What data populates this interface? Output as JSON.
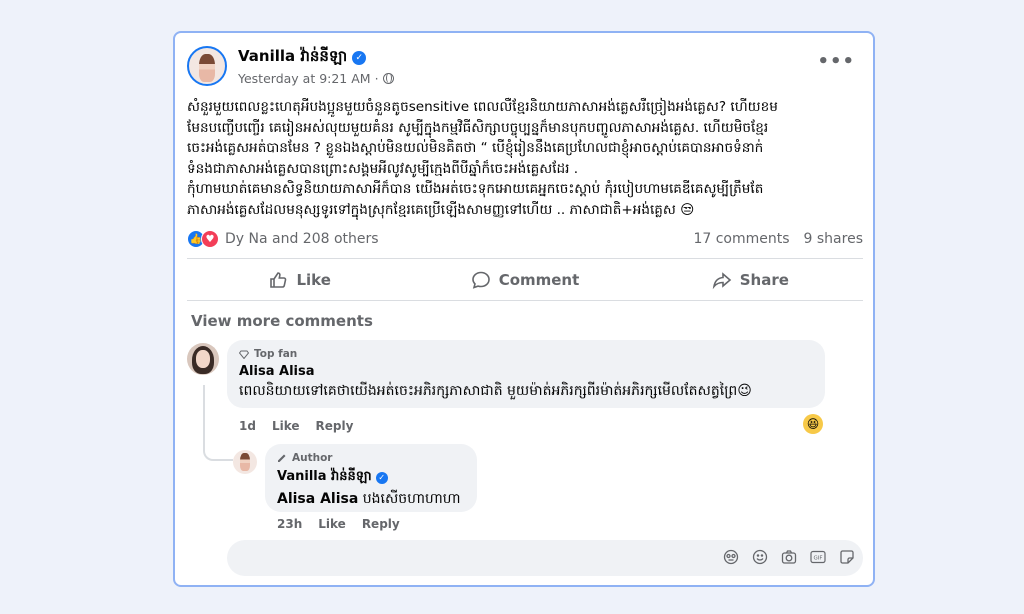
{
  "post": {
    "page_name": "Vanilla វ៉ាន់នីឡា",
    "timestamp": "Yesterday at 9:21 AM",
    "body_lines": [
      "សំនួរមួយពេលខ្លះហេតុអីបងប្អូនមួយចំនួនតូចsensitive ពេលលឺខ្មែរនិយាយភាសាអង់គ្លេសរឺច្រៀងអង់គ្លេស? ហើយខម",
      "មែនបញ្ចើបញ្ចើរ គេរៀនអស់លុយមួយគំនរ សូម្បីក្នុងកម្មវិធីសិក្សាបច្ចុប្បន្នក៏មានបុកបញ្ចូលភាសាអង់គ្លេស. ហើយមិចខ្មែរ",
      "ចេះអង់គ្លេសអត់បានមែន ? ខ្លួនឯងស្ដាប់មិនយល់មិនគិតថា  “ បើខ្ញុំរៀននឹងគេប្រហែលជាខ្ញុំអាចស្តាប់គេបានអាចទំនាក់",
      "ទំនងជាភាសាអង់គ្លេសបានព្រោះសង្គមអីលូវសូម្បីក្មេងពីបីឆ្នាំក៏ចេះអង់គ្លេសដែរ .",
      "កុំហាមឃាត់គេមានសិទ្ធនិយាយភាសាអីក៏បាន យើងអត់ចេះទុកអោយគេអ្នកចេះស្ដាប់ កុំរបៀបហាមគេឌីគេសូម្បីត្រឹមតែ",
      "ភាសាអង់គ្លេសដែលមនុស្សទូរទៅក្នុងស្រុកខ្មែរគេប្រើឡើងសាមញ្ញទៅហើយ ..  ភាសាជាតិ+អង់គ្លេស 😒"
    ],
    "reactions_text": "Dy Na and 208 others",
    "comments_count": "17 comments",
    "shares_count": "9 shares"
  },
  "actions": {
    "like": "Like",
    "comment": "Comment",
    "share": "Share"
  },
  "view_more": "View more comments",
  "comments": [
    {
      "badge": "Top fan",
      "author": "Alisa Alisa",
      "text": "ពេលនិយាយទៅគេថាយើងអត់ចេះអភិរក្សភាសាជាតិ មួយម៉ាត់អភិរក្សពីរម៉ាត់អភិរក្សមើលតែសត្វព្រៃ😉",
      "time": "1d",
      "like": "Like",
      "reply": "Reply",
      "reaction_icon": "laughing-emoji"
    }
  ],
  "reply": {
    "badge": "Author",
    "author": "Vanilla វ៉ាន់នីឡា",
    "mention": "Alisa Alisa",
    "text": " បងសើចហាហាហា",
    "time": "23h",
    "like": "Like",
    "reply": "Reply"
  },
  "colors": {
    "accent": "#1877f2",
    "border": "#8fb2f4",
    "bubble": "#f0f2f5",
    "muted": "#65676b"
  }
}
